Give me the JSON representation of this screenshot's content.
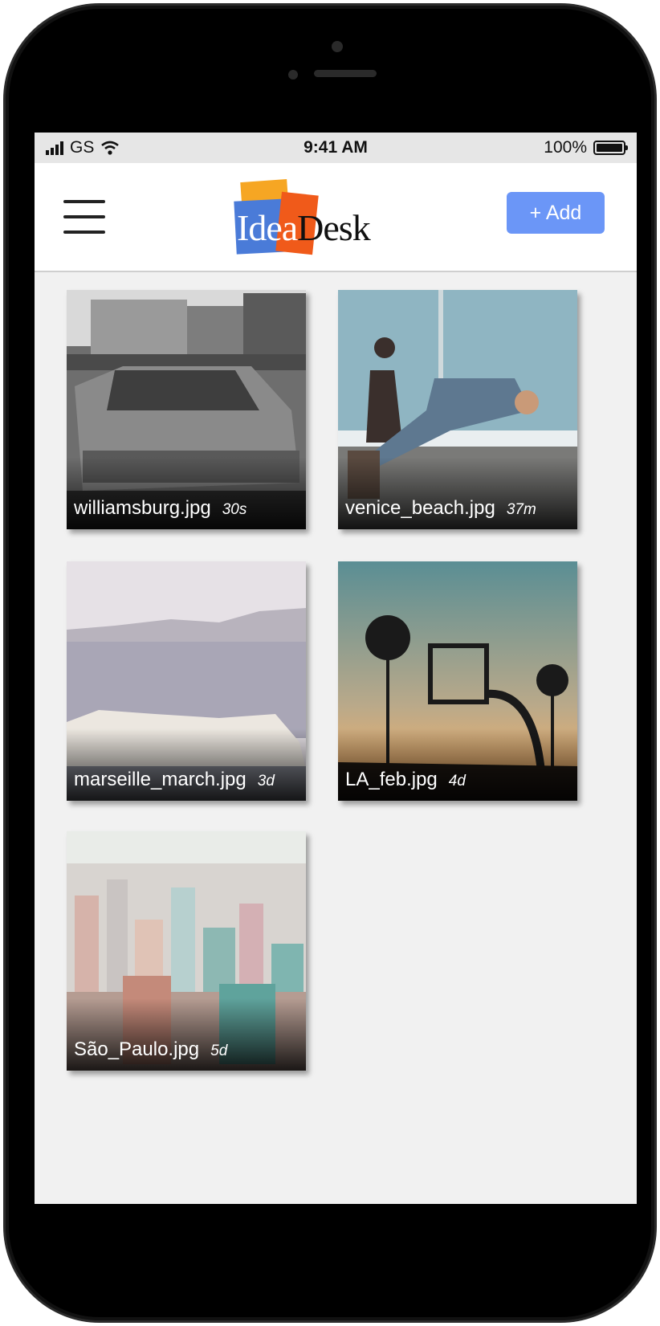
{
  "status_bar": {
    "carrier": "GS",
    "time": "9:41 AM",
    "battery": "100%"
  },
  "header": {
    "logo_idea": "Idea",
    "logo_desk": "Desk",
    "add_label": "+ Add"
  },
  "colors": {
    "accent": "#6b96f7",
    "logo_orange": "#f6a623",
    "logo_blue": "#4a7bd8",
    "logo_red": "#f05a1a"
  },
  "files": [
    {
      "name": "williamsburg.jpg",
      "age": "30s"
    },
    {
      "name": "venice_beach.jpg",
      "age": "37m"
    },
    {
      "name": "marseille_march.jpg",
      "age": "3d"
    },
    {
      "name": "LA_feb.jpg",
      "age": "4d"
    },
    {
      "name": "São_Paulo.jpg",
      "age": "5d"
    }
  ]
}
